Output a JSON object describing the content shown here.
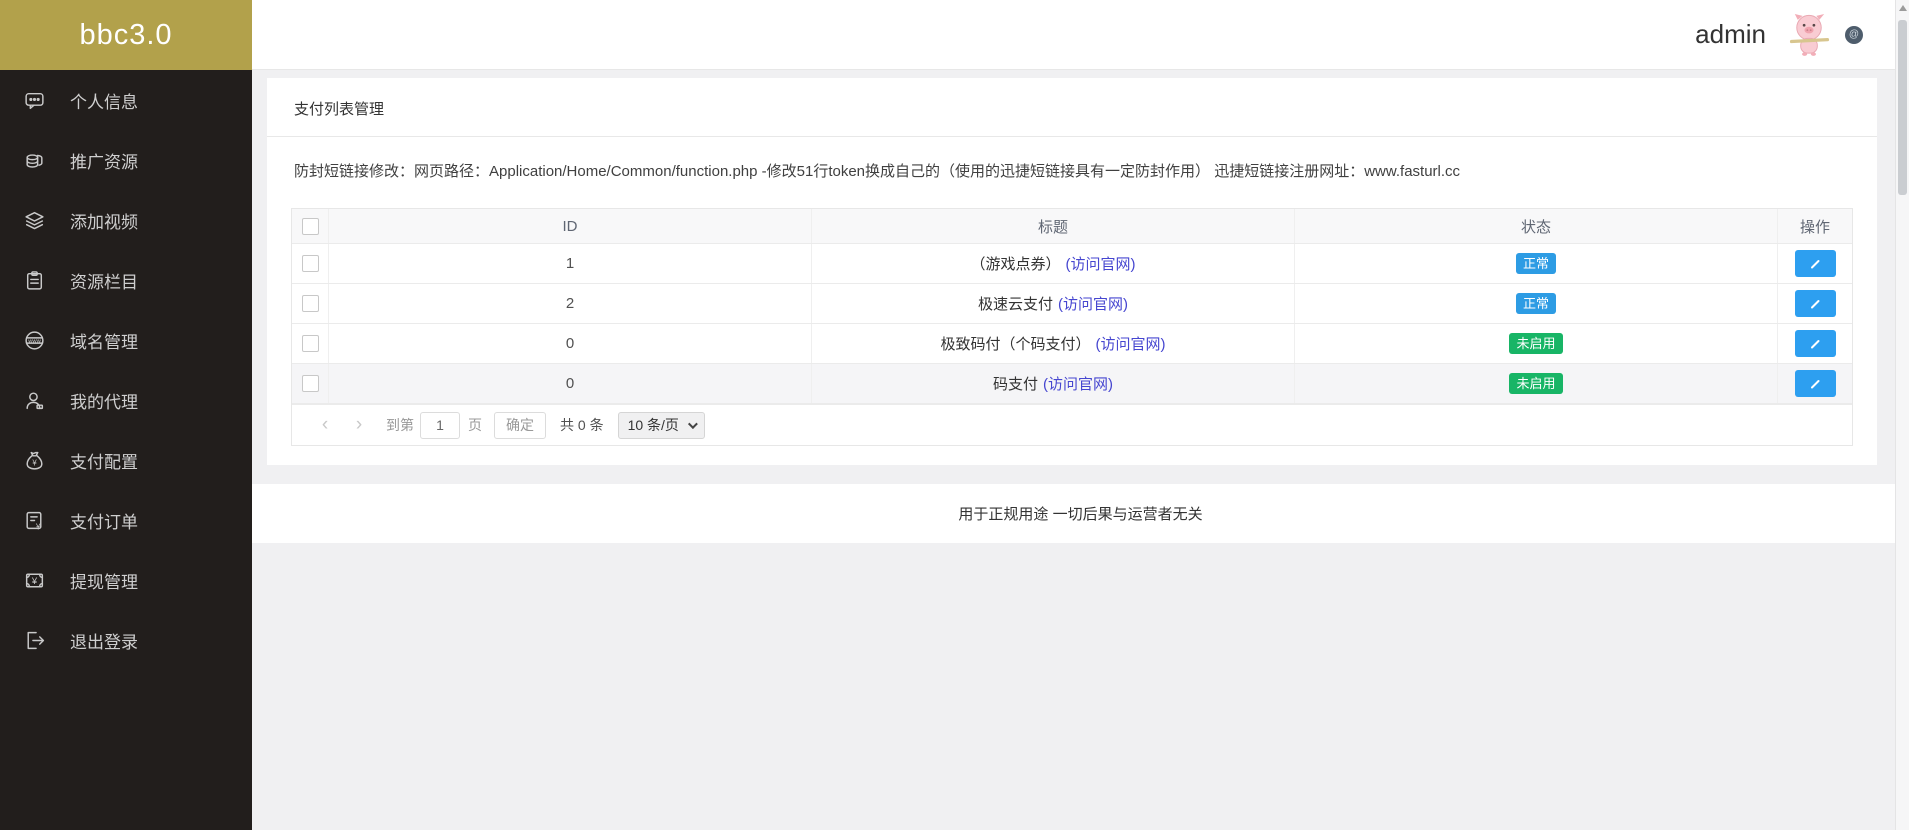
{
  "colors": {
    "logo_bg": "#b2a14b",
    "sidebar_bg": "#221e1c",
    "status_normal_bg": "#2d9ce4",
    "status_disabled_bg": "#18b566",
    "edit_button_bg": "#2d9ff0",
    "link_color": "#4646d0"
  },
  "sidebar": {
    "logo": "bbc3.0",
    "items": [
      {
        "label": "个人信息",
        "icon": "chat-icon"
      },
      {
        "label": "推广资源",
        "icon": "coins-icon"
      },
      {
        "label": "添加视频",
        "icon": "layers-icon"
      },
      {
        "label": "资源栏目",
        "icon": "clipboard-icon"
      },
      {
        "label": "域名管理",
        "icon": "globe-www-icon"
      },
      {
        "label": "我的代理",
        "icon": "user-icon"
      },
      {
        "label": "支付配置",
        "icon": "money-bag-icon"
      },
      {
        "label": "支付订单",
        "icon": "receipt-icon"
      },
      {
        "label": "提现管理",
        "icon": "banknote-icon"
      },
      {
        "label": "退出登录",
        "icon": "logout-icon"
      }
    ]
  },
  "topbar": {
    "username": "admin",
    "avatar": "pig-avatar",
    "corner_icon": "comment-icon"
  },
  "page": {
    "title": "支付列表管理",
    "notice": "防封短链接修改：网页路径：Application/Home/Common/function.php -修改51行token换成自己的（使用的迅捷短链接具有一定防封作用） 迅捷短链接注册网址：www.fasturl.cc"
  },
  "table": {
    "headers": {
      "id": "ID",
      "title": "标题",
      "status": "状态",
      "action": "操作"
    },
    "rows": [
      {
        "id": "1",
        "title": "（游戏点券）",
        "link": "(访问官网)",
        "status": "正常"
      },
      {
        "id": "2",
        "title": "极速云支付",
        "link": "(访问官网)",
        "status": "正常"
      },
      {
        "id": "0",
        "title": "极致码付（个码支付）",
        "link": "(访问官网)",
        "status": "未启用"
      },
      {
        "id": "0",
        "title": "码支付",
        "link": "(访问官网)",
        "status": "未启用"
      }
    ]
  },
  "pagination": {
    "prev": "‹",
    "next": "›",
    "goto_label": "到第",
    "page_value": "1",
    "page_unit": "页",
    "confirm": "确定",
    "total": "共 0 条",
    "page_size": "10 条/页"
  },
  "footer": {
    "disclaimer": "用于正规用途 一切后果与运营者无关"
  }
}
